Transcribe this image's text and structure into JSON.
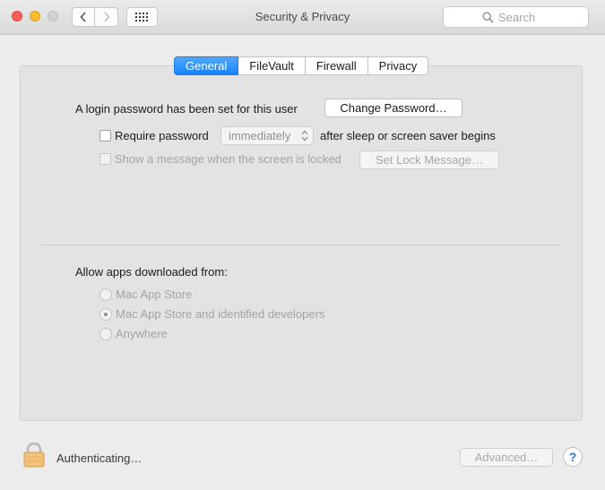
{
  "window": {
    "title": "Security & Privacy"
  },
  "search": {
    "placeholder": "Search"
  },
  "tabs": [
    {
      "label": "General",
      "active": true
    },
    {
      "label": "FileVault",
      "active": false
    },
    {
      "label": "Firewall",
      "active": false
    },
    {
      "label": "Privacy",
      "active": false
    }
  ],
  "general": {
    "login_password_label": "A login password has been set for this user",
    "change_password_button": "Change Password…",
    "require_password_label": "Require password",
    "require_password_checked": false,
    "require_password_delay": "immediately",
    "after_sleep_label": "after sleep or screen saver begins",
    "show_message_label": "Show a message when the screen is locked",
    "show_message_checked": false,
    "set_lock_message_button": "Set Lock Message…",
    "allow_apps_label": "Allow apps downloaded from:",
    "allow_apps_options": [
      {
        "label": "Mac App Store",
        "selected": false
      },
      {
        "label": "Mac App Store and identified developers",
        "selected": true
      },
      {
        "label": "Anywhere",
        "selected": false
      }
    ]
  },
  "footer": {
    "status_text": "Authenticating…",
    "advanced_button": "Advanced…",
    "help_button": "?"
  },
  "icons": {
    "back": "chevron-left-icon",
    "forward": "chevron-right-icon",
    "show_all": "grid-icon",
    "search": "search-icon",
    "lock": "lock-icon",
    "popup_arrows": "updown-arrows-icon"
  },
  "colors": {
    "active_tab": "#1584fb",
    "close": "#fc5f57",
    "minimize": "#fdbc2e",
    "help_mark": "#2b7de0"
  }
}
